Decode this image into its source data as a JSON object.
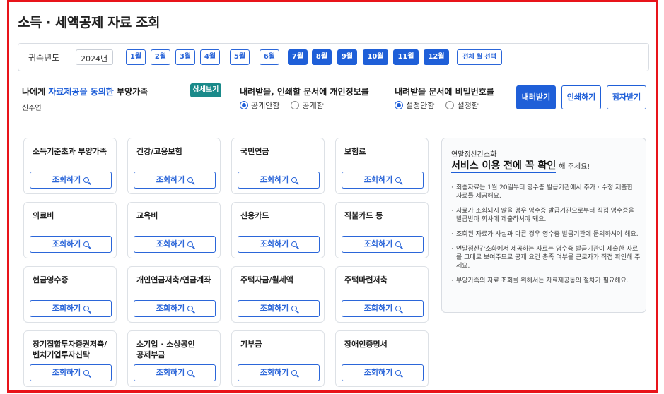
{
  "page": {
    "title": "소득 · 세액공제 자료 조회"
  },
  "year_bar": {
    "label": "귀속년도",
    "year": "2024년",
    "months": [
      {
        "label": "1월",
        "selected": false
      },
      {
        "label": "2월",
        "selected": false
      },
      {
        "label": "3월",
        "selected": false
      },
      {
        "label": "4월",
        "selected": false
      },
      {
        "label": "5월",
        "selected": false
      },
      {
        "label": "6월",
        "selected": false
      },
      {
        "label": "7월",
        "selected": true
      },
      {
        "label": "8월",
        "selected": true
      },
      {
        "label": "9월",
        "selected": true
      },
      {
        "label": "10월",
        "selected": true
      },
      {
        "label": "11월",
        "selected": true
      },
      {
        "label": "12월",
        "selected": true
      }
    ],
    "all_months": "전체 월 선택"
  },
  "consent": {
    "prefix": "나에게 ",
    "highlight": "자료제공을 동의한",
    "suffix": " 부양가족",
    "family_member": "신주연",
    "detail_button": "상세보기"
  },
  "privacy": {
    "label": "내려받을, 인쇄할 문서에 개인정보를",
    "options": [
      "공개안함",
      "공개함"
    ],
    "selected": 0
  },
  "password": {
    "label": "내려받을 문서에 비밀번호를",
    "options": [
      "설정안함",
      "설정함"
    ],
    "selected": 0
  },
  "actions": {
    "download": "내려받기",
    "print": "인쇄하기",
    "braille": "점자받기"
  },
  "query_label": "조회하기",
  "cards": [
    "소득기준초과 부양가족",
    "건강/고용보험",
    "국민연금",
    "보험료",
    "의료비",
    "교육비",
    "신용카드",
    "직불카드 등",
    "현금영수증",
    "개인연금저축/연금계좌",
    "주택자금/월세액",
    "주택마련저축",
    "장기집합투자증권저축/\n벤처기업투자신탁",
    "소기업 · 소상공인\n공제부금",
    "기부금",
    "장애인증명서"
  ],
  "info": {
    "subtitle": "연말정산간소화",
    "heading": "서비스 이용 전에 꼭 확인",
    "heading_suffix": "해 주세요!",
    "notes": [
      "최종자료는 1월 20일부터 영수증 발급기관에서 추가 · 수정 제출한 자료를 제공해요.",
      "자료가 조회되지 않을 경우 영수증 발급기관으로부터 직접 영수증을 발급받아 회사에 제출하셔야 돼요.",
      "조회된 자료가 사실과 다른 경우 영수증 발급기관에 문의하셔야 해요.",
      "연말정산간소화에서 제공하는 자료는 영수증 발급기관이 제출한 자료를 그대로 보여주므로 공제 요건 충족 여부를 근로자가 직접 확인해 주세요.",
      "부양가족의 자료 조회를 위해서는 자료제공동의 절차가 필요해요."
    ]
  },
  "colors": {
    "primary": "#1f5fd8",
    "teal": "#1a8a8a",
    "frame": "#e8141a"
  }
}
